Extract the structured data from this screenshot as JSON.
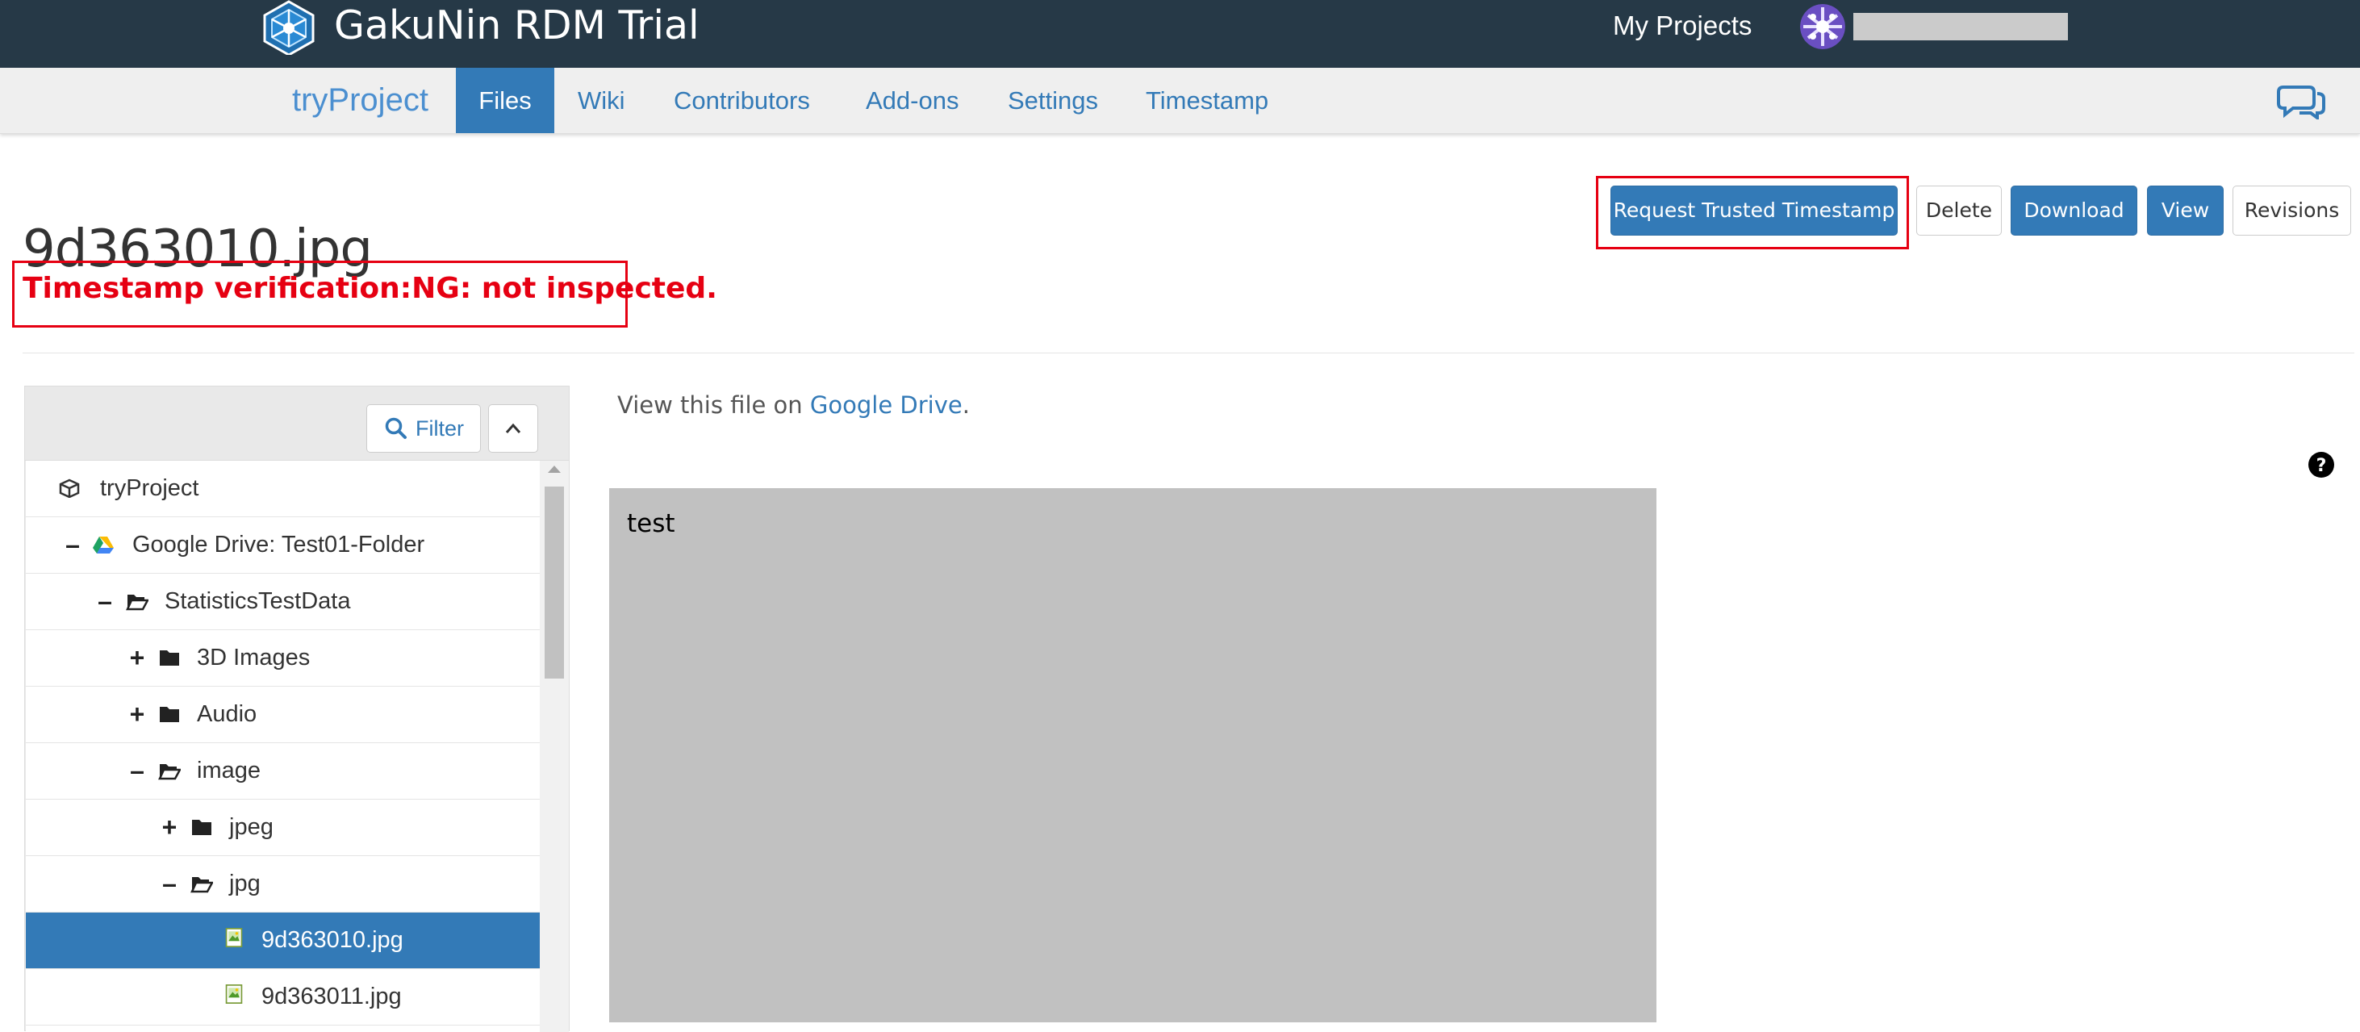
{
  "topbar": {
    "brand_title": "GakuNin RDM Trial",
    "my_projects_label": "My Projects",
    "bg_color": "#263947"
  },
  "project_nav": {
    "project_name": "tryProject",
    "tabs": [
      {
        "label": "Files",
        "active": true
      },
      {
        "label": "Wiki"
      },
      {
        "label": "Contributors"
      },
      {
        "label": "Add-ons"
      },
      {
        "label": "Settings"
      },
      {
        "label": "Timestamp"
      }
    ]
  },
  "file": {
    "title": "9d363010.jpg",
    "timestamp_status": "Timestamp verification:NG: not inspected."
  },
  "actions": {
    "request_timestamp": "Request Trusted Timestamp",
    "delete": "Delete",
    "download": "Download",
    "view": "View",
    "revisions": "Revisions"
  },
  "tree": {
    "filter_label": "Filter",
    "items": [
      {
        "name": "tryProject",
        "icon": "cube-icon"
      },
      {
        "name": "Google Drive: Test01-Folder",
        "icon": "google-drive-icon",
        "toggle": "–"
      },
      {
        "name": "StatisticsTestData",
        "icon": "folder-open-icon",
        "toggle": "–"
      },
      {
        "name": "3D Images",
        "icon": "folder-icon",
        "toggle": "+"
      },
      {
        "name": "Audio",
        "icon": "folder-icon",
        "toggle": "+"
      },
      {
        "name": "image",
        "icon": "folder-open-icon",
        "toggle": "–"
      },
      {
        "name": "jpeg",
        "icon": "folder-icon",
        "toggle": "+"
      },
      {
        "name": "jpg",
        "icon": "folder-open-icon",
        "toggle": "–"
      },
      {
        "name": "9d363010.jpg",
        "icon": "image-file-icon",
        "selected": true
      },
      {
        "name": "9d363011.jpg",
        "icon": "image-file-icon"
      }
    ]
  },
  "viewer": {
    "view_prefix": "View this file on ",
    "view_link": "Google Drive",
    "view_suffix": ".",
    "preview_text": "test"
  },
  "colors": {
    "accent": "#337ab7",
    "alert": "#e60012",
    "preview_bg": "#c1c1c1"
  }
}
